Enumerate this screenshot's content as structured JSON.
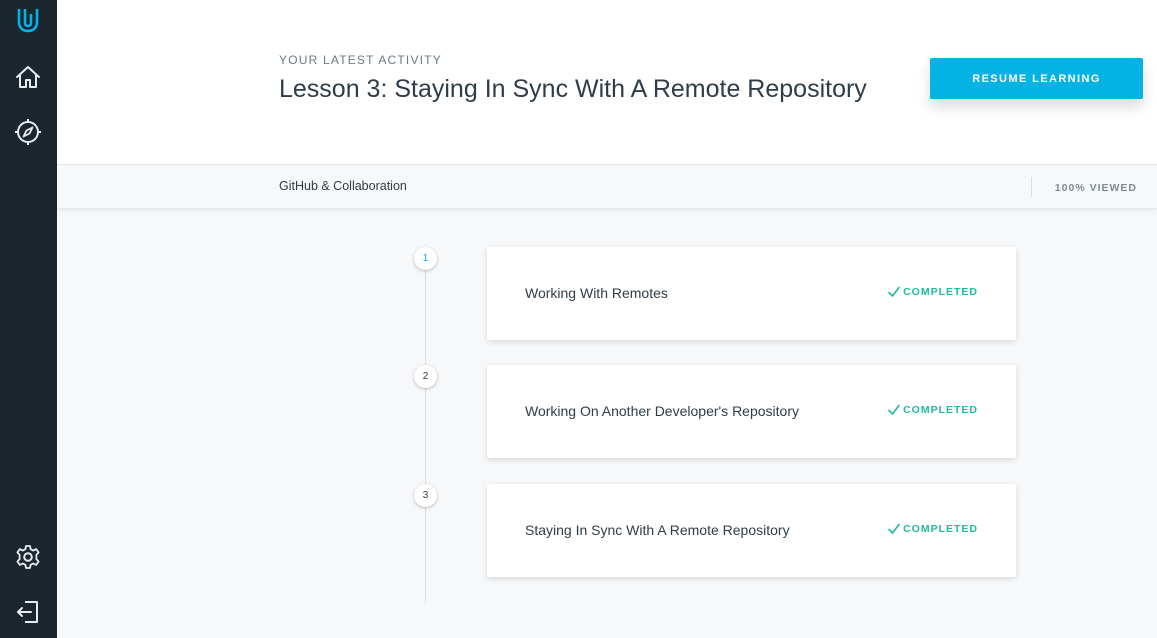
{
  "sidebar": {
    "top_icons": [
      "udacity-logo-icon",
      "home-icon",
      "compass-icon"
    ],
    "bottom_icons": [
      "settings-gear-icon",
      "logout-icon"
    ]
  },
  "header": {
    "eyebrow": "YOUR LATEST ACTIVITY",
    "lesson_title": "Lesson 3: Staying In Sync With A Remote Repository",
    "resume_label": "RESUME LEARNING"
  },
  "subbar": {
    "course_name": "GitHub & Collaboration",
    "viewed": "100% VIEWED"
  },
  "concepts": [
    {
      "number": "1",
      "title": "Working With Remotes",
      "status": "COMPLETED"
    },
    {
      "number": "2",
      "title": "Working On Another Developer's Repository",
      "status": "COMPLETED"
    },
    {
      "number": "3",
      "title": "Staying In Sync With A Remote Repository",
      "status": "COMPLETED"
    }
  ],
  "colors": {
    "sidebar_bg": "#1c262f",
    "accent": "#02b3e4",
    "completed": "#1fbb9c",
    "text": "#2e3d49"
  }
}
